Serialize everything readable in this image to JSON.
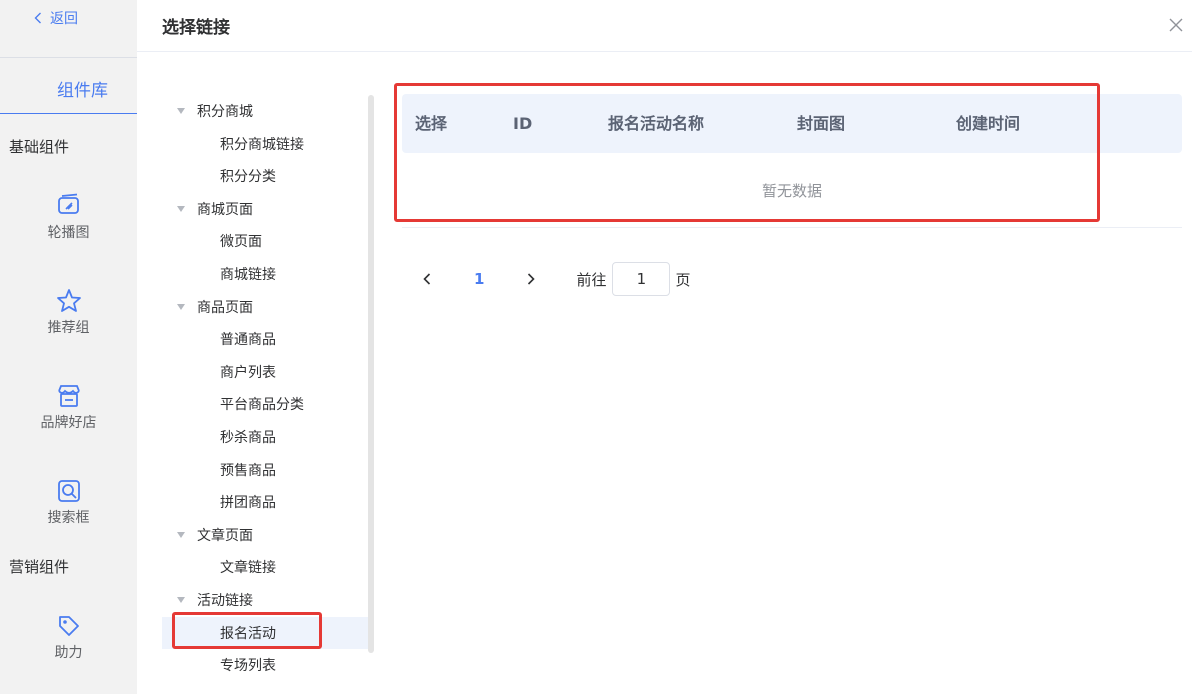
{
  "sidebar": {
    "back_label": "返回",
    "library_title": "组件库",
    "groups": [
      {
        "title": "基础组件"
      },
      {
        "title": "营销组件"
      }
    ],
    "components": [
      {
        "label": "轮播图",
        "icon": "carousel-icon"
      },
      {
        "label": "推荐组",
        "icon": "star-icon"
      },
      {
        "label": "品牌好店",
        "icon": "store-icon"
      },
      {
        "label": "搜索框",
        "icon": "search-icon"
      },
      {
        "label": "助力",
        "icon": "tag-icon"
      }
    ]
  },
  "dialog": {
    "title": "选择链接"
  },
  "tree": [
    {
      "label": "积分商城",
      "type": "parent"
    },
    {
      "label": "积分商城链接",
      "type": "child"
    },
    {
      "label": "积分分类",
      "type": "child"
    },
    {
      "label": "商城页面",
      "type": "parent"
    },
    {
      "label": "微页面",
      "type": "child"
    },
    {
      "label": "商城链接",
      "type": "child"
    },
    {
      "label": "商品页面",
      "type": "parent"
    },
    {
      "label": "普通商品",
      "type": "child"
    },
    {
      "label": "商户列表",
      "type": "child"
    },
    {
      "label": "平台商品分类",
      "type": "child"
    },
    {
      "label": "秒杀商品",
      "type": "child"
    },
    {
      "label": "预售商品",
      "type": "child"
    },
    {
      "label": "拼团商品",
      "type": "child"
    },
    {
      "label": "文章页面",
      "type": "parent"
    },
    {
      "label": "文章链接",
      "type": "child"
    },
    {
      "label": "活动链接",
      "type": "parent"
    },
    {
      "label": "报名活动",
      "type": "child",
      "active": true
    },
    {
      "label": "专场列表",
      "type": "child"
    }
  ],
  "table": {
    "columns": [
      "选择",
      "ID",
      "报名活动名称",
      "封面图",
      "创建时间"
    ],
    "empty_text": "暂无数据"
  },
  "pagination": {
    "current_page": "1",
    "goto_label": "前往",
    "goto_value": "1",
    "page_suffix": "页"
  },
  "colors": {
    "accent": "#4a7cf0",
    "highlight_box": "#e53935",
    "header_bg": "#eef3fc",
    "sidebar_bg": "#f2f2f2"
  }
}
